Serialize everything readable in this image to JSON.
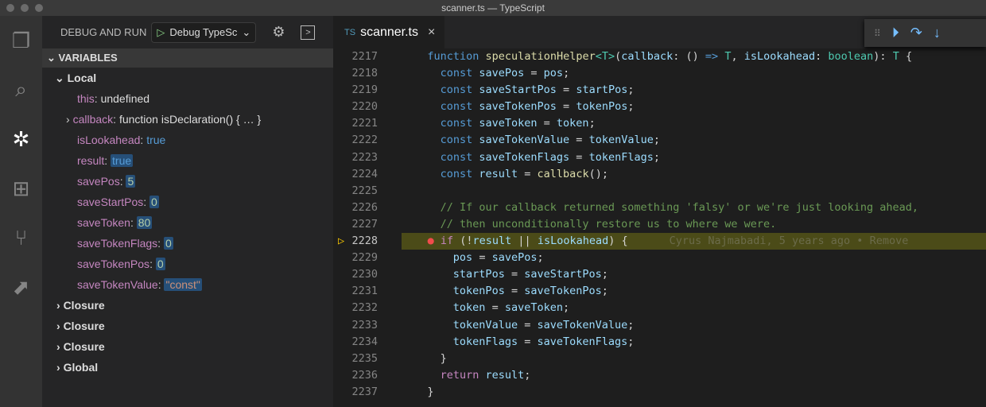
{
  "window_title": "scanner.ts — TypeScript",
  "sidebar": {
    "title": "DEBUG AND RUN",
    "config": "Debug TypeSc",
    "section": "VARIABLES",
    "local": "Local",
    "vars": [
      {
        "name": "this",
        "value": "undefined",
        "kind": "plain"
      },
      {
        "name": "callback",
        "value": "function isDeclaration() { … }",
        "kind": "plain",
        "expandable": true
      },
      {
        "name": "isLookahead",
        "value": "true",
        "kind": "bool"
      },
      {
        "name": "result",
        "value": "true",
        "kind": "bool",
        "hl": true
      },
      {
        "name": "savePos",
        "value": "5",
        "kind": "num",
        "hl": true
      },
      {
        "name": "saveStartPos",
        "value": "0",
        "kind": "num",
        "hl": true
      },
      {
        "name": "saveToken",
        "value": "80",
        "kind": "num",
        "hl": true
      },
      {
        "name": "saveTokenFlags",
        "value": "0",
        "kind": "num",
        "hl": true
      },
      {
        "name": "saveTokenPos",
        "value": "0",
        "kind": "num",
        "hl": true
      },
      {
        "name": "saveTokenValue",
        "value": "\"const\"",
        "kind": "str",
        "hl": true
      }
    ],
    "scopes": [
      "Closure",
      "Closure",
      "Closure",
      "Global"
    ]
  },
  "tab": {
    "lang": "TS",
    "file": "scanner.ts"
  },
  "editor": {
    "blame": "Cyrus Najmabadi, 5 years ago • Remove",
    "current_line": 2228,
    "lines": [
      {
        "n": 2217,
        "i": 4,
        "t": [
          [
            "kw",
            "function "
          ],
          [
            "fn",
            "speculationHelper"
          ],
          [
            "ty",
            "<T>"
          ],
          [
            "p",
            "("
          ],
          [
            "v",
            "callback"
          ],
          [
            "p",
            ": () "
          ],
          [
            "kw",
            "=>"
          ],
          [
            "ty",
            " T"
          ],
          [
            "p",
            ", "
          ],
          [
            "v",
            "isLookahead"
          ],
          [
            "p",
            ": "
          ],
          [
            "ty",
            "boolean"
          ],
          [
            "p",
            "): "
          ],
          [
            "ty",
            "T"
          ],
          [
            "p",
            " {"
          ]
        ]
      },
      {
        "n": 2218,
        "i": 6,
        "t": [
          [
            "kw",
            "const "
          ],
          [
            "v",
            "savePos"
          ],
          [
            "p",
            " = "
          ],
          [
            "v",
            "pos"
          ],
          [
            "p",
            ";"
          ]
        ]
      },
      {
        "n": 2219,
        "i": 6,
        "t": [
          [
            "kw",
            "const "
          ],
          [
            "v",
            "saveStartPos"
          ],
          [
            "p",
            " = "
          ],
          [
            "v",
            "startPos"
          ],
          [
            "p",
            ";"
          ]
        ]
      },
      {
        "n": 2220,
        "i": 6,
        "t": [
          [
            "kw",
            "const "
          ],
          [
            "v",
            "saveTokenPos"
          ],
          [
            "p",
            " = "
          ],
          [
            "v",
            "tokenPos"
          ],
          [
            "p",
            ";"
          ]
        ]
      },
      {
        "n": 2221,
        "i": 6,
        "t": [
          [
            "kw",
            "const "
          ],
          [
            "v",
            "saveToken"
          ],
          [
            "p",
            " = "
          ],
          [
            "v",
            "token"
          ],
          [
            "p",
            ";"
          ]
        ]
      },
      {
        "n": 2222,
        "i": 6,
        "t": [
          [
            "kw",
            "const "
          ],
          [
            "v",
            "saveTokenValue"
          ],
          [
            "p",
            " = "
          ],
          [
            "v",
            "tokenValue"
          ],
          [
            "p",
            ";"
          ]
        ]
      },
      {
        "n": 2223,
        "i": 6,
        "t": [
          [
            "kw",
            "const "
          ],
          [
            "v",
            "saveTokenFlags"
          ],
          [
            "p",
            " = "
          ],
          [
            "v",
            "tokenFlags"
          ],
          [
            "p",
            ";"
          ]
        ]
      },
      {
        "n": 2224,
        "i": 6,
        "t": [
          [
            "kw",
            "const "
          ],
          [
            "v",
            "result"
          ],
          [
            "p",
            " = "
          ],
          [
            "fn",
            "callback"
          ],
          [
            "p",
            "();"
          ]
        ]
      },
      {
        "n": 2225,
        "i": 0,
        "t": []
      },
      {
        "n": 2226,
        "i": 6,
        "t": [
          [
            "cm",
            "// If our callback returned something 'falsy' or we're just looking ahead,"
          ]
        ]
      },
      {
        "n": 2227,
        "i": 6,
        "t": [
          [
            "cm",
            "// then unconditionally restore us to where we were."
          ]
        ]
      },
      {
        "n": 2228,
        "i": 6,
        "t": [
          [
            "ctl",
            "if"
          ],
          [
            "p",
            " (!"
          ],
          [
            "v",
            "result"
          ],
          [
            "p",
            " || "
          ],
          [
            "v",
            "isLookahead"
          ],
          [
            "p",
            ") {"
          ]
        ]
      },
      {
        "n": 2229,
        "i": 8,
        "t": [
          [
            "v",
            "pos"
          ],
          [
            "p",
            " = "
          ],
          [
            "v",
            "savePos"
          ],
          [
            "p",
            ";"
          ]
        ]
      },
      {
        "n": 2230,
        "i": 8,
        "t": [
          [
            "v",
            "startPos"
          ],
          [
            "p",
            " = "
          ],
          [
            "v",
            "saveStartPos"
          ],
          [
            "p",
            ";"
          ]
        ]
      },
      {
        "n": 2231,
        "i": 8,
        "t": [
          [
            "v",
            "tokenPos"
          ],
          [
            "p",
            " = "
          ],
          [
            "v",
            "saveTokenPos"
          ],
          [
            "p",
            ";"
          ]
        ]
      },
      {
        "n": 2232,
        "i": 8,
        "t": [
          [
            "v",
            "token"
          ],
          [
            "p",
            " = "
          ],
          [
            "v",
            "saveToken"
          ],
          [
            "p",
            ";"
          ]
        ]
      },
      {
        "n": 2233,
        "i": 8,
        "t": [
          [
            "v",
            "tokenValue"
          ],
          [
            "p",
            " = "
          ],
          [
            "v",
            "saveTokenValue"
          ],
          [
            "p",
            ";"
          ]
        ]
      },
      {
        "n": 2234,
        "i": 8,
        "t": [
          [
            "v",
            "tokenFlags"
          ],
          [
            "p",
            " = "
          ],
          [
            "v",
            "saveTokenFlags"
          ],
          [
            "p",
            ";"
          ]
        ]
      },
      {
        "n": 2235,
        "i": 6,
        "t": [
          [
            "p",
            "}"
          ]
        ]
      },
      {
        "n": 2236,
        "i": 6,
        "t": [
          [
            "ctl",
            "return "
          ],
          [
            "v",
            "result"
          ],
          [
            "p",
            ";"
          ]
        ]
      },
      {
        "n": 2237,
        "i": 4,
        "t": [
          [
            "p",
            "}"
          ]
        ]
      }
    ]
  }
}
